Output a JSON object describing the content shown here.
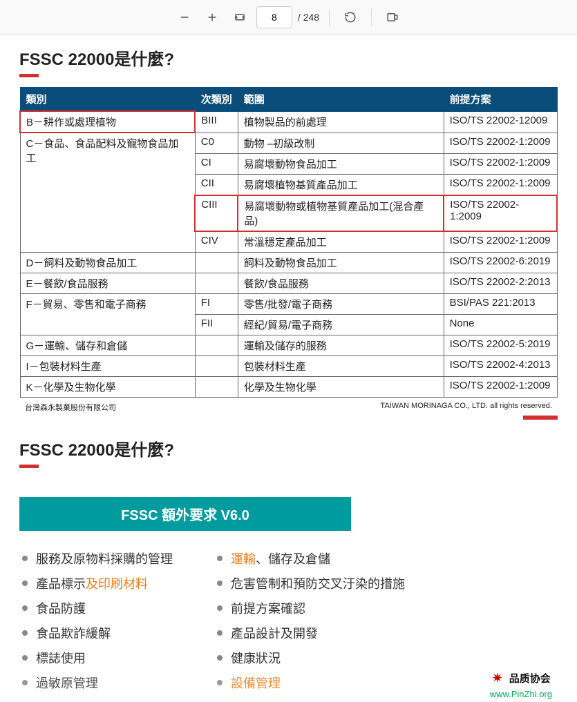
{
  "toolbar": {
    "page_current": "8",
    "page_total": "/ 248"
  },
  "page1": {
    "title": "FSSC 22000是什麼?",
    "table": {
      "headers": [
        "類別",
        "次類別",
        "範圍",
        "前提方案"
      ],
      "rows": [
        {
          "cat": "B－耕作或處理植物",
          "catRowspan": 1,
          "highlightCat": true,
          "sub": "BIII",
          "scope": "植物製品的前處理",
          "prog": "ISO/TS 22002-12009",
          "highlightRest": false
        },
        {
          "cat": "C－食品、食品配料及寵物食品加工",
          "catRowspan": 5,
          "highlightCat": false,
          "sub": "C0",
          "scope": "動物 –初級改制",
          "prog": "ISO/TS 22002-1:2009",
          "highlightRest": false
        },
        {
          "cat": null,
          "sub": "CI",
          "scope": "易腐壞動物食品加工",
          "prog": "ISO/TS 22002-1:2009",
          "highlightRest": false
        },
        {
          "cat": null,
          "sub": "CII",
          "scope": "易腐壞植物基質產品加工",
          "prog": "ISO/TS 22002-1:2009",
          "highlightRest": false
        },
        {
          "cat": null,
          "sub": "CIII",
          "scope": "易腐壞動物或植物基質產品加工(混合產品)",
          "prog": "ISO/TS 22002-1:2009",
          "highlightRest": true
        },
        {
          "cat": null,
          "sub": "CIV",
          "scope": "常溫穩定產品加工",
          "prog": "ISO/TS 22002-1:2009",
          "highlightRest": false
        },
        {
          "cat": "D－飼料及動物食品加工",
          "catRowspan": 1,
          "sub": "",
          "scope": "飼料及動物食品加工",
          "prog": "ISO/TS 22002-6:2019",
          "highlightRest": false
        },
        {
          "cat": "E－餐飲/食品服務",
          "catRowspan": 1,
          "sub": "",
          "scope": "餐飲/食品服務",
          "prog": "ISO/TS 22002-2:2013",
          "highlightRest": false
        },
        {
          "cat": "F－貿易、零售和電子商務",
          "catRowspan": 2,
          "sub": "FI",
          "scope": "零售/批發/電子商務",
          "prog": "BSI/PAS 221:2013",
          "highlightRest": false
        },
        {
          "cat": null,
          "sub": "FII",
          "scope": "經紀/貿易/電子商務",
          "prog": "None",
          "highlightRest": false
        },
        {
          "cat": "G－運輸、儲存和倉儲",
          "catRowspan": 1,
          "sub": "",
          "scope": "運輸及儲存的服務",
          "prog": "ISO/TS 22002-5:2019",
          "highlightRest": false
        },
        {
          "cat": "I－包裝材料生產",
          "catRowspan": 1,
          "sub": "",
          "scope": "包裝材料生產",
          "prog": "ISO/TS 22002-4:2013",
          "highlightRest": false
        },
        {
          "cat": "K－化學及生物化學",
          "catRowspan": 1,
          "sub": "",
          "scope": "化學及生物化學",
          "prog": "ISO/TS 22002-1:2009",
          "highlightRest": false
        }
      ]
    },
    "footer_left": "台灣森永製菓股份有限公司",
    "footer_right": "TAIWAN MORINAGA CO., LTD. all rights reserved."
  },
  "page2": {
    "title": "FSSC 22000是什麼?",
    "banner": "FSSC 額外要求 V6.0",
    "left": [
      {
        "t": "服務及原物料採購的管理"
      },
      {
        "t": "產品標示及印刷材料",
        "orange": "及印刷材料"
      },
      {
        "t": "食品防護"
      },
      {
        "t": "食品欺詐緩解"
      },
      {
        "t": "標誌使用"
      },
      {
        "t": "過敏原管理",
        "cut": true
      }
    ],
    "right": [
      {
        "t": "運輸、儲存及倉儲",
        "orange": "運輸"
      },
      {
        "t": "危害管制和預防交叉汙染的措施"
      },
      {
        "t": "前提方案確認"
      },
      {
        "t": "產品設計及開發"
      },
      {
        "t": "健康狀況"
      },
      {
        "t": "設備管理",
        "orange": "設備管理",
        "cut": true
      }
    ]
  },
  "logo": {
    "title": "品质协会",
    "url": "www.PinZhi.org"
  }
}
